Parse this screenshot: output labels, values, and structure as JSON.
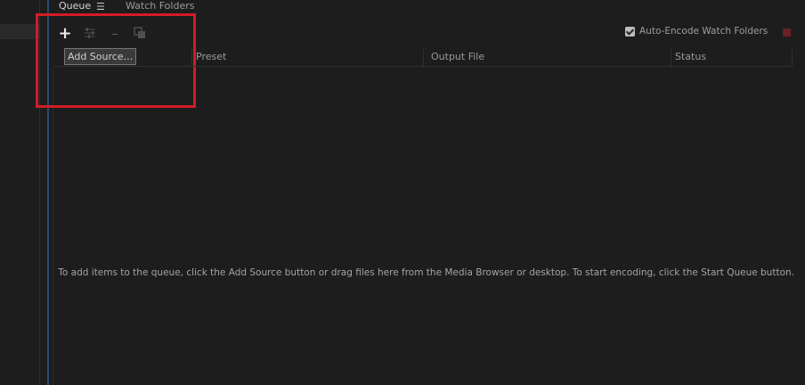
{
  "tabs": {
    "queue": "Queue",
    "watch_folders": "Watch Folders"
  },
  "toolbar": {
    "add_icon": "plus-icon",
    "settings_icon": "sliders-icon",
    "remove_icon": "minus-icon",
    "duplicate_icon": "duplicate-icon",
    "tooltip": "Add Source..."
  },
  "auto_encode": {
    "label": "Auto-Encode Watch Folders",
    "checked": true
  },
  "columns": [
    "Preset",
    "Output File",
    "Status"
  ],
  "empty_message": "To add items to the queue, click the Add Source button or drag files here from the Media Browser or desktop.  To start encoding, click the Start Queue button.",
  "colors": {
    "highlight": "#d21c27",
    "start_queue": "#6b2025"
  }
}
